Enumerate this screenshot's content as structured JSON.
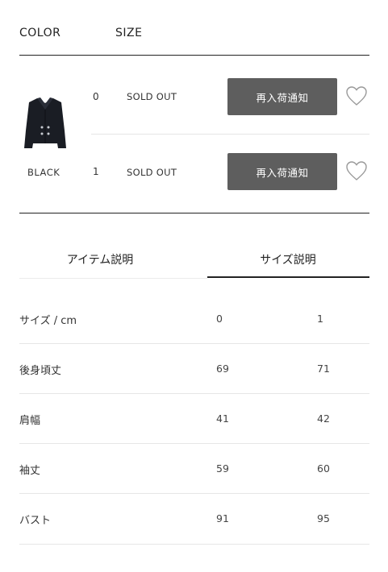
{
  "header": {
    "color_label": "COLOR",
    "size_label": "SIZE"
  },
  "product": {
    "color_name": "BLACK",
    "variants": [
      {
        "size": "0",
        "status": "SOLD OUT",
        "button_label": "再入荷通知"
      },
      {
        "size": "1",
        "status": "SOLD OUT",
        "button_label": "再入荷通知"
      }
    ]
  },
  "tabs": {
    "item_description": "アイテム説明",
    "size_description": "サイズ説明",
    "active": "size_description"
  },
  "size_table": {
    "header": {
      "label": "サイズ / cm",
      "col0": "0",
      "col1": "1"
    },
    "rows": [
      {
        "label": "後身頃丈",
        "col0": "69",
        "col1": "71"
      },
      {
        "label": "肩幅",
        "col0": "41",
        "col1": "42"
      },
      {
        "label": "袖丈",
        "col0": "59",
        "col1": "60"
      },
      {
        "label": "バスト",
        "col0": "91",
        "col1": "95"
      }
    ]
  }
}
